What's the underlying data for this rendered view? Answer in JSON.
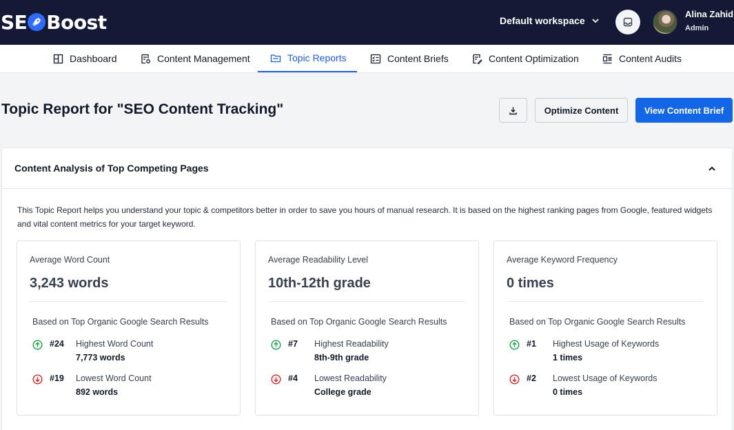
{
  "header": {
    "logo_left": "SE",
    "logo_right": "Boost",
    "workspace": "Default workspace",
    "user_name": "Alina Zahid",
    "user_role": "Admin"
  },
  "nav": {
    "items": [
      {
        "label": "Dashboard",
        "icon": "layout-grid-icon"
      },
      {
        "label": "Content Management",
        "icon": "document-settings-icon"
      },
      {
        "label": "Topic Reports",
        "icon": "folder-icon",
        "active": true
      },
      {
        "label": "Content Briefs",
        "icon": "checklist-icon"
      },
      {
        "label": "Content Optimization",
        "icon": "document-edit-icon"
      },
      {
        "label": "Content Audits",
        "icon": "audit-list-icon"
      }
    ]
  },
  "page": {
    "title": "Topic Report for \"SEO Content Tracking\"",
    "buttons": {
      "optimize": "Optimize Content",
      "view_brief": "View Content Brief"
    }
  },
  "panel": {
    "title": "Content Analysis of Top Competing Pages",
    "intro": "This Topic Report helps you understand your topic & competitors better in order to save you hours of manual research. It is based on the highest ranking pages from Google, featured widgets and vital content metrics for your target keyword.",
    "cards": [
      {
        "label": "Average Word Count",
        "value": "3,243 words",
        "basis": "Based on Top Organic Google Search Results",
        "high": {
          "rank": "#24",
          "label": "Highest Word Count",
          "value": "7,773 words"
        },
        "low": {
          "rank": "#19",
          "label": "Lowest Word Count",
          "value": "892 words"
        }
      },
      {
        "label": "Average Readability Level",
        "value": "10th-12th grade",
        "basis": "Based on Top Organic Google Search Results",
        "high": {
          "rank": "#7",
          "label": "Highest Readability",
          "value": "8th-9th grade"
        },
        "low": {
          "rank": "#4",
          "label": "Lowest Readability",
          "value": "College grade"
        }
      },
      {
        "label": "Average Keyword Frequency",
        "value": "0 times",
        "basis": "Based on Top Organic Google Search Results",
        "high": {
          "rank": "#1",
          "label": "Highest Usage of Keywords",
          "value": "1 times"
        },
        "low": {
          "rank": "#2",
          "label": "Lowest Usage of Keywords",
          "value": "0 times"
        }
      }
    ]
  },
  "colors": {
    "header_bg": "#141a36",
    "accent": "#1366e6",
    "up": "#16a34a",
    "down": "#dc2626"
  }
}
